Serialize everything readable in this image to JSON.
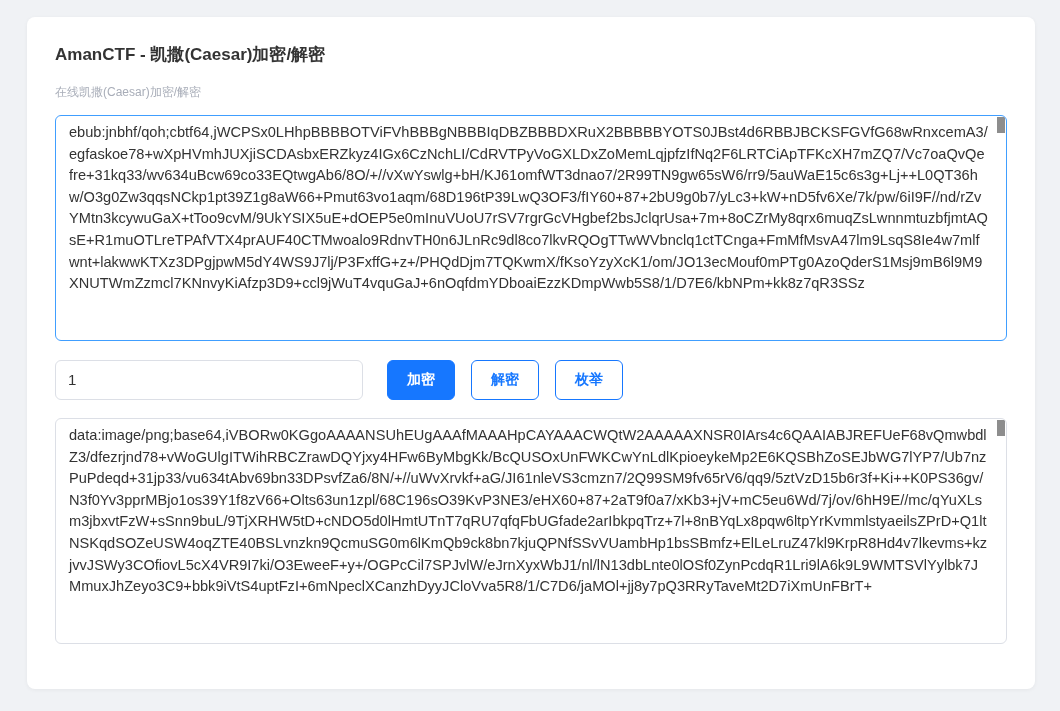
{
  "title": "AmanCTF - 凯撒(Caesar)加密/解密",
  "subtitle": "在线凯撒(Caesar)加密/解密",
  "input_text": {
    "focused": true,
    "value": "ebub:jnbhf/qoh;cbtf64,jWCPSx0LHhpBBBBOTViFVhBBBgNBBBIqDBZBBBDXRuX2BBBBBYOTS0JBst4d6RBBJBCKSFGVfG68wRnxcemA3/egfaskoe78+wXpHVmhJUXjiSCDAsbxERZkyz4IGx6CzNchLI/CdRVTPyVoGXLDxZoMemLqjpfzIfNq2F6LRTCiApTFKcXH7mZQ7/Vc7oaQvQefre+31kq33/wv634uBcw69co33EQtwgAb6/8O/+//vXwYswlg+bH/KJ61omfWT3dnao7/2R99TN9gw65sW6/rr9/5auWaE15c6s3g+Lj++L0QT36hw/O3g0Zw3qqsNCkp1pt39Z1g8aW66+Pmut63vo1aqm/68D196tP39LwQ3OF3/fIY60+87+2bU9g0b7/yLc3+kW+nD5fv6Xe/7k/pw/6iI9F//nd/rZvYMtn3kcywuGaX+tToo9cvM/9UkYSIX5uE+dOEP5e0mInuVUoU7rSV7rgrGcVHgbef2bsJclqrUsa+7m+8oCZrMy8qrx6muqZsLwnnmtuzbfjmtAQsE+R1muOTLreTPAfVTX4prAUF40CTMwoalo9RdnvTH0n6JLnRc9dl8co7lkvRQOgTTwWVbnclq1ctTCnga+FmMfMsvA47lm9LsqS8Ie4w7mlfwnt+lakwwKTXz3DPgjpwM5dY4WS9J7lj/P3FxffG+z+/PHQdDjm7TQKwmX/fKsoYzyXcK1/om/JO13ecMouf0mPTg0AzoQderS1Msj9mB6l9M9XNUTWmZzmcl7KNnvyKiAfzp3D9+ccl9jWuT4vquGaJ+6nOqfdmYDboaiEzzKDmpWwb5S8/1/D7E6/kbNPm+kk8z7qR3SSz"
  },
  "shift_field": {
    "value": "1"
  },
  "buttons": [
    {
      "label": "加密",
      "kind": "primary"
    },
    {
      "label": "解密",
      "kind": "outline"
    },
    {
      "label": "枚举",
      "kind": "outline"
    }
  ],
  "output_text": {
    "focused": false,
    "value": "data:image/png;base64,iVBORw0KGgoAAAANSUhEUgAAAfMAAAHpCAYAAACWQtW2AAAAAXNSR0IArs4c6QAAIABJREFUeF68vQmwbdlZ3/dfezrjnd78+vWoGUlgITWihRBCZrawDQYjxy4HFw6ByMbgKk/BcQUSOxUnFWKCwYnLdlKpioeykeMp2E6KQSBhZoSEJbWG7lYP7/Ub7nzPuPdeqd+31jp33/vu634tAbv69bn33DPsvfZa6/8N/+//uWvXrvkf+aG/JI61nleVS3cmzn7/2Q99SM9fv65rV6/qq9/5ztVzD15b6r3f+Ki++K0PS36gv/N3f0Yv3pprMBjo1os39Y1f8zV66+Olts63un1zpl/68C196sO39KvP3NE3/eHX60+87+2aT9f0a7/xKb3+jV+mC5eu6Wd/7j/ov/6hH9E//mc/qYuXLsm3jbxvtFzW+sSnn9buL/9TjXRHW5tD+cNDO5d0lHmtUTnT7qRU7qfqFbUGfade2arIbkpqTrz+7l+8nBYqLx8pqw6ltpYrKvmmlstyaeilsZPrD+Q1ltNSKqdSOZeUSW4oqZTE40BSLvnzkn9QcmuSG0m6lKmQb9ck8bn7kjuQPNfSSvVUambHp1bsSBmfz+ElLeLruZ47kl9KrpR8Hd4v7lkevms+kzjvvJSWy3COfiovL5cX4VR9I7ki/O3EweeF+y+/OGPcCil7SPJvlW/eJrnXyxWbJ1/nl/lN13dbLnte0lOSf0ZynPcdqR1Lri9lA6k9L9WMTSVlYylbk7JMmuxJhZeyo3C9+bbk9iVtS4uptFzI+6mNpeclXCanzhDyyJCloVva5R8/1/C7D6/jaMOl+jj8y7pQ3RRyTaveMt2D7iXmUnFBrT+"
  }
}
